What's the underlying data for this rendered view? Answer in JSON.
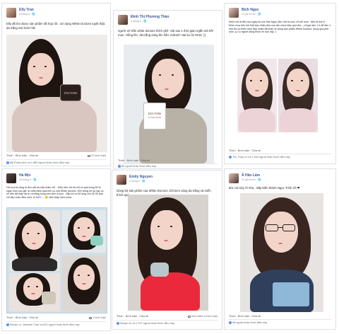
{
  "posts": [
    {
      "name": "Elly Tran",
      "time": "5 tháng 6 · ",
      "text": "Elly đã tìm được sản phẩm rất hợp rồi , sử dụng White Doctors tuyệt thật. da trắng mịn luôn hihi",
      "actions": "Thích · Bình luận · Chia sẻ",
      "comments": "23 bình luận",
      "likes": "Mỹ Phạm Anh và 1.883 người khác thích điều này",
      "photo_colors": {
        "bg": "#eeeae8",
        "hair": "#1d130f",
        "skin": "#f1d7cf",
        "top": "#d9c6c0"
      },
      "jar_label": "DOCTORS"
    },
    {
      "name": "Đinh Thị Phương Thảo",
      "time": "3 tháng 6 · ",
      "text": "người ơi! trắn white doctors thích ghê. Xài sau 1 thời gian ngắn mà hết mụn. Hồng lên, da trắng sáng lên hẳn. Kakoi!!! Hai ko ổn 2015 :))",
      "actions": "Thích · Bình luận · Chia sẻ",
      "likes": "89 người khác thích điều này",
      "photo_colors": {
        "bg": "#e8ecef",
        "hair": "#241813",
        "skin": "#f4dbd2",
        "top": "#b8b2a6"
      },
      "jar_label": "DOCTORS",
      "jar_sub": "ACTIVE WHITE"
    },
    {
      "name": "Bích Ngọc",
      "time": "13 giờ trước · ",
      "text": "Mình mà ai tiểu học ngày ba còn bảo Ngọc đen, thế là mục chỉ chỉ mụn , đến tử thế ở.. Mình mua trên bói biết bao nhiêu tiền mà vẫn chưa hiệu quả đúc , chỉ giờ làm 1 6 dể đen 1 kha lên có thêm kem đẹp white đã khác về đúng sản phẩm White Doctors. dùng quá phê luôn :)) Có người đúng thích về sau này :)",
      "actions": "Thích · Bình luận · Chia sẻ",
      "likes": "Thu Thủy Lê và 1.453 người khác thích điều này",
      "photo_colors": {
        "bg": "#f1e6ea",
        "hair": "#3a2a25",
        "skin": "#f3dcd6",
        "top": "#ecd3d8"
      }
    },
    {
      "name": "Hà Mịn",
      "time": "28 tháng 6 · ",
      "text": "Hồi xưa là cũng bị đen sắt cả mặt chăm chỉ... Kiểu trên vét bả chỉ có quả trong 50 là ngày hôm sau giữ ra chỉa nhỉnh quả tình cụ của White doctors. Mìn dùng bớ sạ này có mì trên đả thấy da tự ra trắng hồng xem tiền ấ luôn . Sắp tới cố 50 lúng cho 40 50 bao chỉ đẹp xuân điền luôn, tú hú!!! — 😊 cảm thấy hạnh phúc.",
      "actions": "Thích · Bình luận · Chia sẻ",
      "comments": "1 bình luận",
      "likes": "Nhoạc Lư, Monster Tran và 822 người khác thích điều này",
      "photo_colors": {
        "bg": "#cfe0ea",
        "hair": "#1b1210",
        "skin": "#f0d8cf",
        "top": "#2d2a2c"
      }
    },
    {
      "name": "Emily Nguyen",
      "time": "9 tháng 6 · ",
      "text": "Dùng bộ sản phẩm của White Doctors, bôi kem sáng da trắng và miễn thích quá",
      "actions": "Thích · Bình luận · Chia sẻ",
      "comments": "Xem thêm 8 bình luận",
      "likes": "Nhoạc Lê và 2.207 người khác thích điều này",
      "photo_colors": {
        "bg": "#d7d2cd",
        "hair": "#2a1a15",
        "skin": "#f3d8cd",
        "top": "#ea2a3c"
      }
    },
    {
      "name": "Á Hân Lâm",
      "time": "12 giờ trước · ",
      "text": "đúc cải này rõ nha , Sắp biến thành Ngọc Trinh rồi ❤",
      "actions": "Thích · Bình luận · Chia sẻ",
      "likes": "58 người khác thích điều này",
      "photo_colors": {
        "bg": "#e6e3e1",
        "hair": "#3a2620",
        "skin": "#f0d6cb",
        "top": "#2f3f5c"
      }
    }
  ]
}
